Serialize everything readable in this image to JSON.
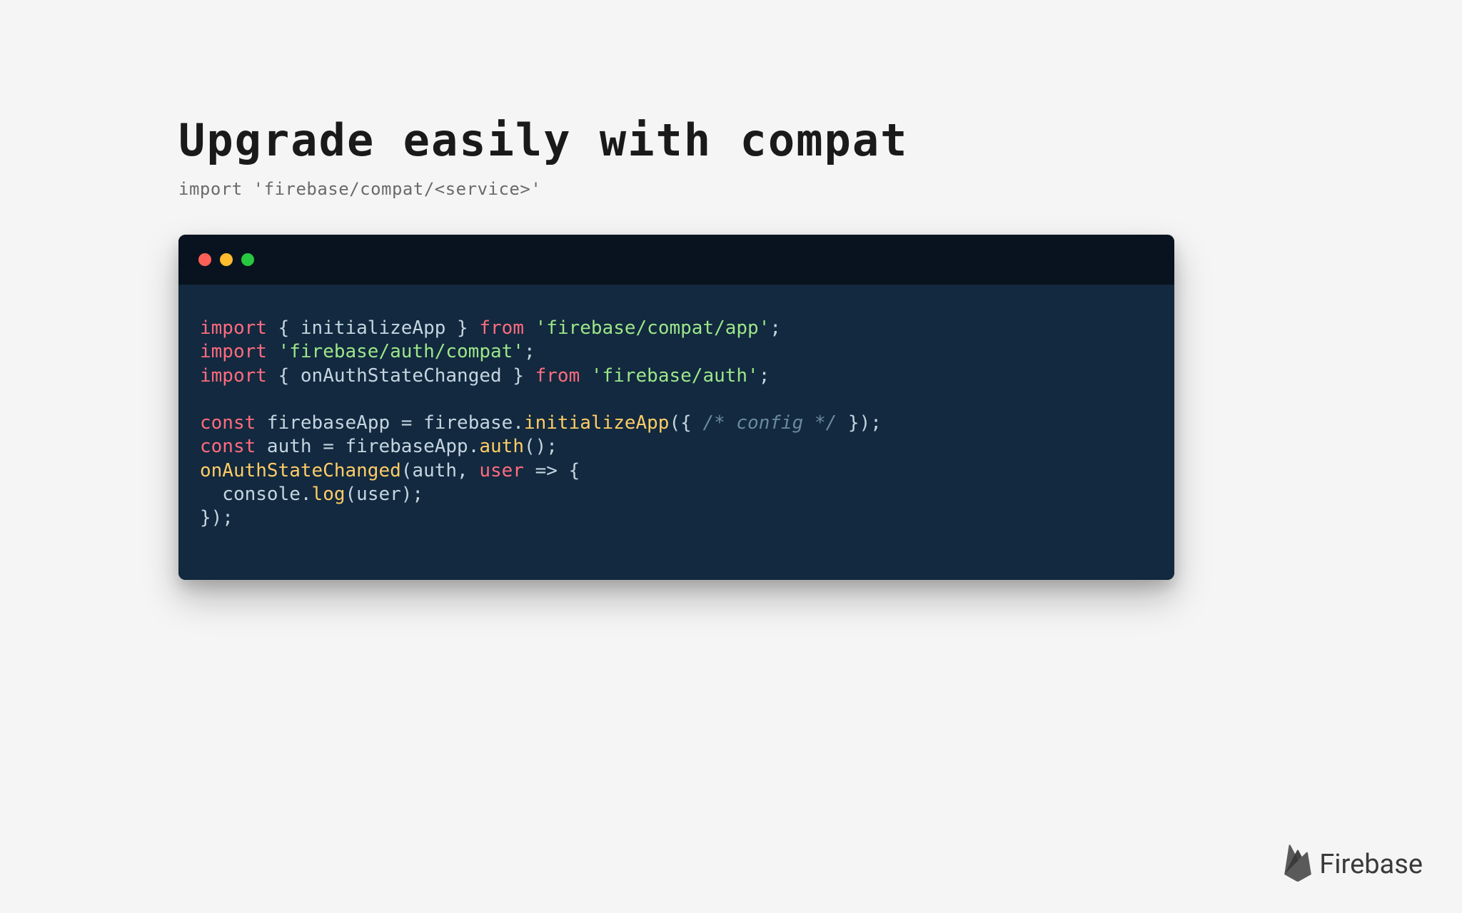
{
  "title": "Upgrade easily with compat",
  "subtitle": "import 'firebase/compat/<service>'",
  "window": {
    "dots": [
      "red",
      "yellow",
      "green"
    ]
  },
  "code": {
    "lines": [
      [
        {
          "t": "import",
          "c": "kw"
        },
        {
          "t": " { ",
          "c": "punc"
        },
        {
          "t": "initializeApp",
          "c": "ident"
        },
        {
          "t": " } ",
          "c": "punc"
        },
        {
          "t": "from",
          "c": "kw"
        },
        {
          "t": " ",
          "c": "punc"
        },
        {
          "t": "'firebase/compat/app'",
          "c": "str"
        },
        {
          "t": ";",
          "c": "punc"
        }
      ],
      [
        {
          "t": "import",
          "c": "kw"
        },
        {
          "t": " ",
          "c": "punc"
        },
        {
          "t": "'firebase/auth/compat'",
          "c": "str"
        },
        {
          "t": ";",
          "c": "punc"
        }
      ],
      [
        {
          "t": "import",
          "c": "kw"
        },
        {
          "t": " { ",
          "c": "punc"
        },
        {
          "t": "onAuthStateChanged",
          "c": "ident"
        },
        {
          "t": " } ",
          "c": "punc"
        },
        {
          "t": "from",
          "c": "kw"
        },
        {
          "t": " ",
          "c": "punc"
        },
        {
          "t": "'firebase/auth'",
          "c": "str"
        },
        {
          "t": ";",
          "c": "punc"
        }
      ],
      [
        {
          "t": "",
          "c": "punc"
        }
      ],
      [
        {
          "t": "const",
          "c": "kw"
        },
        {
          "t": " firebaseApp = firebase.",
          "c": "ident"
        },
        {
          "t": "initializeApp",
          "c": "method"
        },
        {
          "t": "({ ",
          "c": "punc"
        },
        {
          "t": "/* config */",
          "c": "comment"
        },
        {
          "t": " });",
          "c": "punc"
        }
      ],
      [
        {
          "t": "const",
          "c": "kw"
        },
        {
          "t": " auth = firebaseApp.",
          "c": "ident"
        },
        {
          "t": "auth",
          "c": "method"
        },
        {
          "t": "();",
          "c": "punc"
        }
      ],
      [
        {
          "t": "onAuthStateChanged",
          "c": "method"
        },
        {
          "t": "(auth, ",
          "c": "punc"
        },
        {
          "t": "user",
          "c": "param"
        },
        {
          "t": " => {",
          "c": "punc"
        }
      ],
      [
        {
          "t": "  console.",
          "c": "ident"
        },
        {
          "t": "log",
          "c": "method"
        },
        {
          "t": "(user);",
          "c": "punc"
        }
      ],
      [
        {
          "t": "});",
          "c": "punc"
        }
      ]
    ]
  },
  "logo": {
    "text": "Firebase"
  }
}
